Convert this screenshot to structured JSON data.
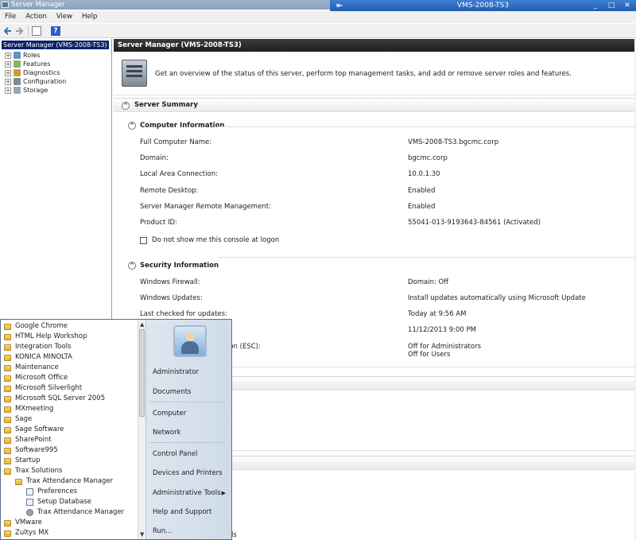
{
  "window": {
    "title": "Server Manager"
  },
  "rdp": {
    "title": "VMS-2008-TS3",
    "minimize": "_",
    "restore": "□",
    "close": "✕",
    "pin": "⇤"
  },
  "menu": {
    "file": "File",
    "action": "Action",
    "view": "View",
    "help": "Help"
  },
  "toolbar": {
    "help_glyph": "?"
  },
  "tree": {
    "root": "Server Manager (VMS-2008-TS3)",
    "items": [
      "Roles",
      "Features",
      "Diagnostics",
      "Configuration",
      "Storage"
    ]
  },
  "panel": {
    "header": "Server Manager (VMS-2008-TS3)",
    "overview": "Get an overview of the status of this server, perform top management tasks, and add or remove server roles and features."
  },
  "summary": {
    "title": "Server Summary",
    "computer_info": {
      "title": "Computer Information",
      "rows": [
        {
          "label": "Full Computer Name:",
          "value": "VMS-2008-TS3.bgcmc.corp"
        },
        {
          "label": "Domain:",
          "value": "bgcmc.corp"
        },
        {
          "label": "Local Area Connection:",
          "value": "10.0.1.30"
        },
        {
          "label": "Remote Desktop:",
          "value": "Enabled"
        },
        {
          "label": "Server Manager Remote Management:",
          "value": "Enabled"
        },
        {
          "label": "Product ID:",
          "value": "55041-013-9193643-84561 (Activated)"
        }
      ],
      "checkbox_label": "Do not show me this console at logon"
    },
    "security_info": {
      "title": "Security Information",
      "rows": [
        {
          "label": "Windows Firewall:",
          "value": "Domain: Off"
        },
        {
          "label": "Windows Updates:",
          "value": "Install updates automatically using Microsoft Update"
        },
        {
          "label": "Last checked for updates:",
          "value": "Today at 9:56 AM"
        },
        {
          "label": "",
          "value": "11/12/2013 9:00 PM"
        },
        {
          "label": "ion (ESC):",
          "value": "Off for Administrators"
        },
        {
          "label": "",
          "value": "Off for Users"
        }
      ]
    },
    "partial_text": "ls"
  },
  "startmenu": {
    "programs": [
      "Google Chrome",
      "HTML Help Workshop",
      "Integration Tools",
      "KONICA MINOLTA",
      "Maintenance",
      "Microsoft Office",
      "Microsoft Silverlight",
      "Microsoft SQL Server 2005",
      "MXmeeting",
      "Sage",
      "Sage Software",
      "SharePoint",
      "Software995",
      "Startup",
      "Trax Solutions",
      "Trax Attendance Manager"
    ],
    "sub_programs": [
      "Preferences",
      "Setup Database",
      "Trax Attendance Manager"
    ],
    "bottom_programs": [
      "VMware",
      "Zultys MX"
    ],
    "links": {
      "user": "Administrator",
      "documents": "Documents",
      "computer": "Computer",
      "network": "Network",
      "control_panel": "Control Panel",
      "devices": "Devices and Printers",
      "admin_tools": "Administrative Tools",
      "help": "Help and Support",
      "run": "Run..."
    }
  }
}
